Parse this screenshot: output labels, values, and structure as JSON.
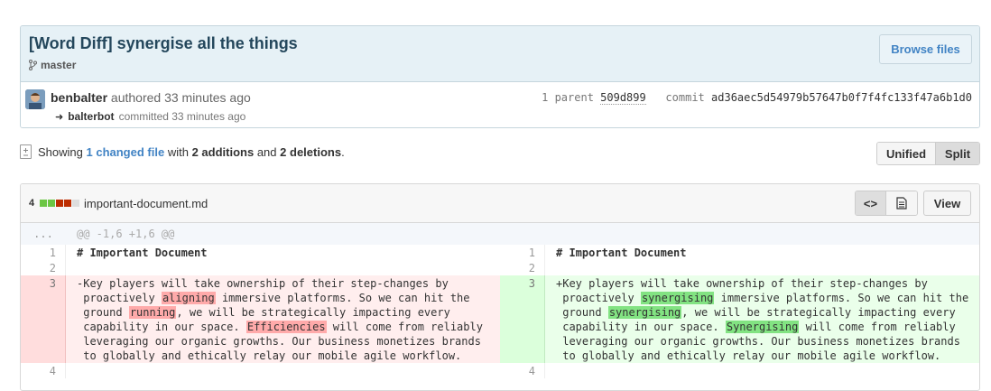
{
  "commit": {
    "title": "[Word Diff] synergise all the things",
    "branch": "master",
    "browse_label": "Browse files",
    "author": "benbalter",
    "authored_text": "authored 33 minutes ago",
    "committer": "balterbot",
    "committed_text": "committed 33 minutes ago",
    "parent_label": "1 parent",
    "parent_sha": "509d899",
    "commit_label": "commit",
    "commit_sha": "ad36aec5d54979b57647b0f7f4fc133f47a6b1d0"
  },
  "toc": {
    "showing": "Showing",
    "changed_link": "1 changed file",
    "with": "with",
    "additions": "2 additions",
    "and": "and",
    "deletions": "2 deletions",
    "period": ".",
    "unified_label": "Unified",
    "split_label": "Split",
    "selected_view": "Split"
  },
  "file": {
    "change_count": "4",
    "diffstat": [
      "add",
      "add",
      "del",
      "del",
      "neutral"
    ],
    "name": "important-document.md",
    "code_icon": "<>",
    "view_label": "View",
    "hunk_ellipsis": "...",
    "hunk_header": "@@ -1,6 +1,6 @@"
  },
  "diff": {
    "left": {
      "line1_num": "1",
      "line1": "# Important Document",
      "line2_num": "2",
      "line2": "",
      "line3_num": "3",
      "del_segments": [
        {
          "t": "-Key players will take ownership of their step-changes by\n proactively ",
          "h": false
        },
        {
          "t": "aligning",
          "h": true
        },
        {
          "t": " immersive platforms. So we can hit the\n ground ",
          "h": false
        },
        {
          "t": "running",
          "h": true
        },
        {
          "t": ", we will be strategically impacting every\n capability in our space. ",
          "h": false
        },
        {
          "t": "Efficiencies",
          "h": true
        },
        {
          "t": " will come from reliably\n leveraging our organic growths. Our business monetizes brands\n to globally and ethically relay our mobile agile workflow.",
          "h": false
        }
      ],
      "line4_num": "4"
    },
    "right": {
      "line1_num": "1",
      "line1": "# Important Document",
      "line2_num": "2",
      "line2": "",
      "line3_num": "3",
      "add_segments": [
        {
          "t": "+Key players will take ownership of their step-changes by\n proactively ",
          "h": false
        },
        {
          "t": "synergising",
          "h": true
        },
        {
          "t": " immersive platforms. So we can hit the\n ground ",
          "h": false
        },
        {
          "t": "synergising",
          "h": true
        },
        {
          "t": ", we will be strategically impacting every\n capability in our space. ",
          "h": false
        },
        {
          "t": "Synergising",
          "h": true
        },
        {
          "t": " will come from reliably\n leveraging our organic growths. Our business monetizes brands\n to globally and ethically relay our mobile agile workflow.",
          "h": false
        }
      ],
      "line4_num": "4"
    }
  },
  "colors": {
    "add_strong": "#82e382",
    "del_strong": "#ffaaaa",
    "link": "#4183c4",
    "header_bg": "#e6f1f6"
  }
}
